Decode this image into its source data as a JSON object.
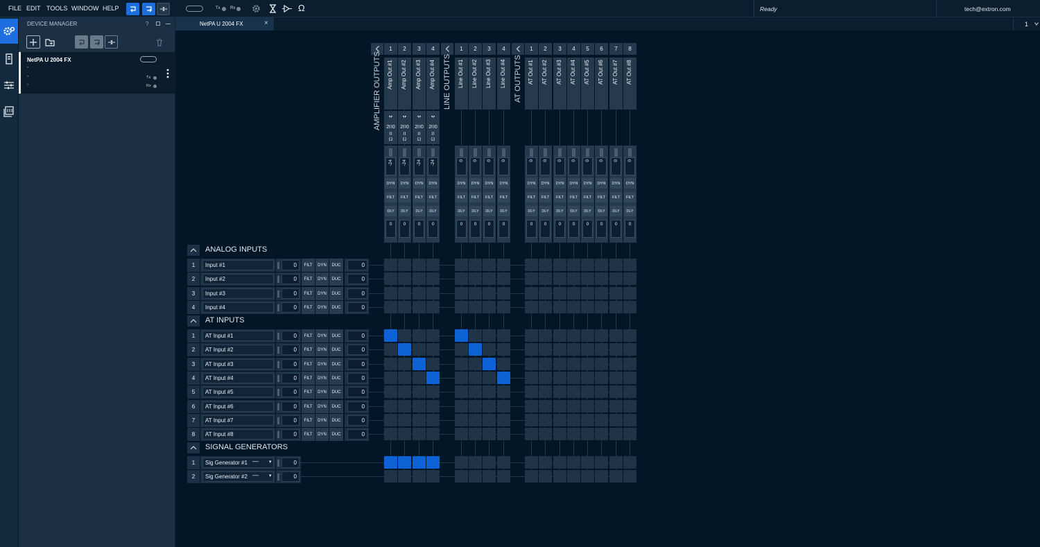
{
  "menu": [
    "FILE",
    "EDIT",
    "TOOLS",
    "WINDOW",
    "HELP"
  ],
  "toolbar": {
    "tx": "Tx",
    "rx": "Rx"
  },
  "status": {
    "text": "Ready",
    "user": "tech@extron.com"
  },
  "device_manager": {
    "title": "DEVICE MANAGER",
    "device_name": "NetPA U 2004 FX",
    "dashes": [
      "-",
      "-",
      "-"
    ],
    "tx": "Tx",
    "rx": "Rx"
  },
  "tab": {
    "label": "NetPA U 2004 FX",
    "page_selector": "1"
  },
  "outputs": {
    "amp_label": "AMPLIFIER OUTPUTS",
    "line_label": "LINE OUTPUTS",
    "at_label": "AT OUTPUTS",
    "amp_nums": [
      "1",
      "2",
      "3",
      "4"
    ],
    "line_nums": [
      "1",
      "2",
      "3",
      "4"
    ],
    "at_nums": [
      "1",
      "2",
      "3",
      "4",
      "5",
      "6",
      "7",
      "8"
    ],
    "amp_names": [
      "Amp Out #1",
      "Amp Out #2",
      "Amp Out #3",
      "Amp Out #4"
    ],
    "line_names": [
      "Line Out #1",
      "Line Out #2",
      "Line Out #3",
      "Line Out #4"
    ],
    "at_names": [
      "AT Out #1",
      "AT Out #2",
      "AT Out #3",
      "AT Out #4",
      "AT Out #5",
      "AT Out #6",
      "AT Out #7",
      "AT Out #8"
    ],
    "amp_power": "200",
    "amp_ohm1": "8",
    "amp_ohm2": "Ω",
    "amp_gain": "-24",
    "other_gain": "0",
    "dyn": "DYN",
    "filt": "FILT",
    "dly": "DLY",
    "bottom_val": "0"
  },
  "sections": {
    "analog": "ANALOG INPUTS",
    "at": "AT INPUTS",
    "sig": "SIGNAL GENERATORS"
  },
  "analog_inputs": [
    {
      "num": "1",
      "name": "Input #1",
      "gain": "0",
      "level": "0"
    },
    {
      "num": "2",
      "name": "Input #2",
      "gain": "0",
      "level": "0"
    },
    {
      "num": "3",
      "name": "Input #3",
      "gain": "0",
      "level": "0"
    },
    {
      "num": "4",
      "name": "Input #4",
      "gain": "0",
      "level": "0"
    }
  ],
  "at_inputs": [
    {
      "num": "1",
      "name": "AT Input #1",
      "gain": "0",
      "level": "0"
    },
    {
      "num": "2",
      "name": "AT Input #2",
      "gain": "0",
      "level": "0"
    },
    {
      "num": "3",
      "name": "AT Input #3",
      "gain": "0",
      "level": "0"
    },
    {
      "num": "4",
      "name": "AT Input #4",
      "gain": "0",
      "level": "0"
    },
    {
      "num": "5",
      "name": "AT Input #5",
      "gain": "0",
      "level": "0"
    },
    {
      "num": "6",
      "name": "AT Input #6",
      "gain": "0",
      "level": "0"
    },
    {
      "num": "7",
      "name": "AT Input #7",
      "gain": "0",
      "level": "0"
    },
    {
      "num": "8",
      "name": "AT Input #8",
      "gain": "0",
      "level": "0"
    }
  ],
  "sig_gens": [
    {
      "num": "1",
      "name": "Sig Generator #1",
      "dash": "—",
      "gain": "0"
    },
    {
      "num": "2",
      "name": "Sig Generator #2",
      "dash": "—",
      "gain": "0"
    }
  ],
  "input_buttons": {
    "filt": "FILT",
    "dyn": "DYN",
    "duc": "DUC"
  },
  "routes": {
    "analog": [],
    "at": [
      [
        0,
        0
      ],
      [
        0,
        4
      ],
      [
        1,
        1
      ],
      [
        1,
        5
      ],
      [
        2,
        2
      ],
      [
        2,
        6
      ],
      [
        3,
        3
      ],
      [
        3,
        7
      ]
    ],
    "sig": [
      [
        0,
        0
      ],
      [
        0,
        1
      ],
      [
        0,
        2
      ],
      [
        0,
        3
      ]
    ]
  },
  "colors": {
    "accent": "#0d63d6",
    "bg": "#031627",
    "cell": "#1f3447"
  }
}
